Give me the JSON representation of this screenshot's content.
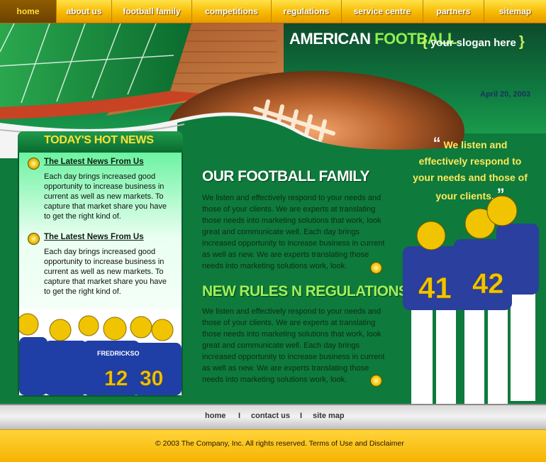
{
  "nav": {
    "items": [
      {
        "label": "home",
        "active": true
      },
      {
        "label": "about us"
      },
      {
        "label": "football family"
      },
      {
        "label": "competitions"
      },
      {
        "label": "regulations"
      },
      {
        "label": "service centre"
      },
      {
        "label": "partners"
      },
      {
        "label": "sitemap"
      }
    ]
  },
  "header": {
    "brand_a": "AMERICAN ",
    "brand_b": "FOOTBALL",
    "slogan_open": "{",
    "slogan": "your slogan here",
    "slogan_close": "}",
    "date": "April 20, 2003"
  },
  "news": {
    "title": "TODAY'S HOT NEWS",
    "items": [
      {
        "link": "The Latest News From Us",
        "text": "Each day brings increased good opportunity to increase business in current as well as new markets. To capture that market share you have to get the right kind of."
      },
      {
        "link": "The Latest News From Us",
        "text": "Each day brings increased good opportunity to increase business in current as well as new markets. To capture that market share you have to get the right kind of."
      }
    ],
    "players": [
      "FREDRICKSO",
      "12",
      "30"
    ]
  },
  "main": {
    "family_title": "OUR FOOTBALL FAMILY",
    "family_text": "We listen and effectively respond to your needs and those of your clients. We are experts at translating those needs into marketing solutions that work, look great and communicate well. Each day brings increased opportunity to increase business in current as well as new.  We are experts translating those needs into marketing solutions work, look.",
    "rules_title": "NEW RULES N REGULATIONS",
    "rules_text": "We listen and effectively respond to your needs and those of your clients. We are experts at translating those needs into marketing solutions that work, look great and communicate well. Each day brings increased opportunity to increase business in current as well as new.  We are experts translating those needs into marketing solutions work, look."
  },
  "quote": {
    "open": "“",
    "text": "We listen and effectively respond to your needs and those of your clients.",
    "close": "”",
    "numbers": [
      "41",
      "42"
    ]
  },
  "footer": {
    "links": [
      "home",
      "contact us",
      "site map"
    ],
    "sep": "I",
    "copyright": "© 2003 The Company, Inc.  All rights reserved. Terms of Use and Disclaimer"
  },
  "colors": {
    "green": "#0e7a3c",
    "yellow": "#f7b900",
    "title_green": "#9ff05a"
  }
}
